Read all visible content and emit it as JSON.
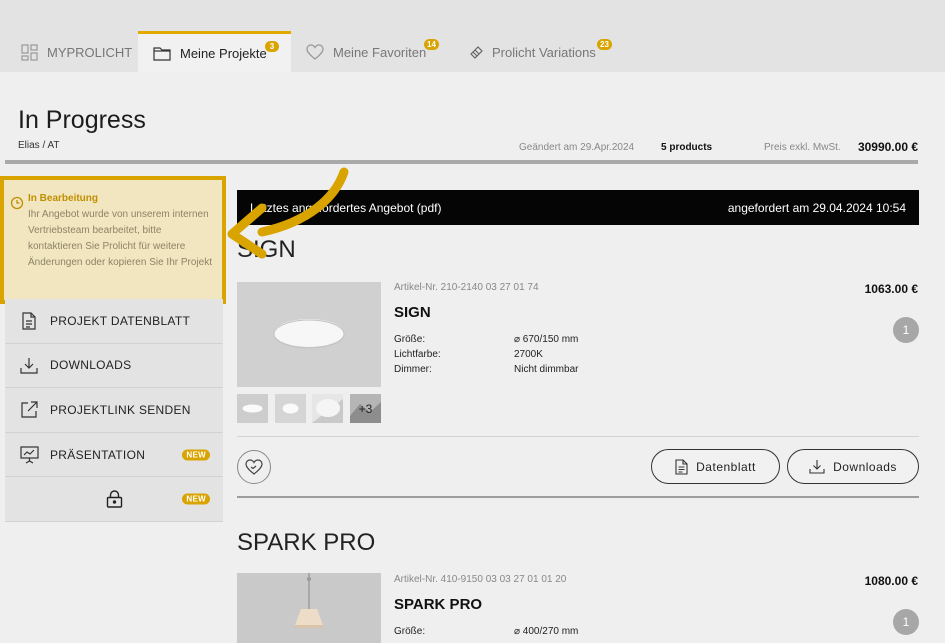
{
  "tabs": [
    {
      "label": "MYPROLICHT",
      "icon": "grid-icon",
      "badge": ""
    },
    {
      "label": "Meine Projekte",
      "icon": "folder-icon",
      "badge": "3"
    },
    {
      "label": "Meine Favoriten",
      "icon": "heart-icon",
      "badge": "14"
    },
    {
      "label": "Prolicht Variations",
      "icon": "palette-icon",
      "badge": "23"
    }
  ],
  "project": {
    "title": "In Progress",
    "subtitle": "Elias / AT",
    "changed": "Geändert am 29.Apr.2024",
    "products_count": "5 products",
    "price_label": "Preis exkl. MwSt.",
    "price_total": "30990.00 €"
  },
  "notice": {
    "title": "In Bearbeitung",
    "text": "Ihr Angebot wurde von unserem internen Vertriebsteam bearbeitet, bitte kontaktieren Sie Prolicht für weitere Änderungen oder kopieren Sie Ihr Projekt"
  },
  "sidebar": {
    "items": [
      {
        "label": "PROJEKT DATENBLATT",
        "icon": "document-icon"
      },
      {
        "label": "DOWNLOADS",
        "icon": "download-icon"
      },
      {
        "label": "PROJEKTLINK SENDEN",
        "icon": "external-link-icon"
      },
      {
        "label": "PRÄSENTATION",
        "icon": "presentation-icon",
        "badge": "NEW"
      },
      {
        "label": "",
        "icon": "lock-icon",
        "badge": "NEW"
      }
    ]
  },
  "request_bar": {
    "left": "Letztes angefordertes Angebot (pdf)",
    "right": "angefordert am 29.04.2024 10:54"
  },
  "products": [
    {
      "heading": "SIGN",
      "article": "Artikel-Nr. 210-2140 03 27 01 74",
      "name": "SIGN",
      "price": "1063.00 €",
      "qty": "1",
      "specs": [
        {
          "k": "Größe:",
          "v": "⌀ 670/150 mm"
        },
        {
          "k": "Lichtfarbe:",
          "v": "2700K"
        },
        {
          "k": "Dimmer:",
          "v": "Nicht dimmbar"
        }
      ],
      "more_thumbs": "+3",
      "datasheet_label": "Datenblatt",
      "downloads_label": "Downloads"
    },
    {
      "heading": "SPARK PRO",
      "article": "Artikel-Nr. 410-9150 03 03 27 01 01 20",
      "name": "SPARK PRO",
      "price": "1080.00 €",
      "qty": "1",
      "specs": [
        {
          "k": "Größe:",
          "v": "⌀ 400/270 mm"
        }
      ]
    }
  ],
  "colors": {
    "accent": "#d9a400",
    "bar": "#050505",
    "background": "#efefef"
  }
}
